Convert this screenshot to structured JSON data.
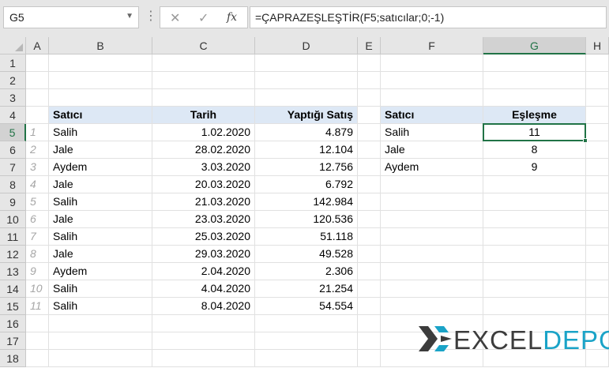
{
  "formula_bar": {
    "name_box": "G5",
    "cancel_glyph": "✕",
    "enter_glyph": "✓",
    "fx_label": "fx",
    "formula": "=ÇAPRAZEŞLEŞTİR(F5;satıcılar;0;-1)"
  },
  "columns": [
    "A",
    "B",
    "C",
    "D",
    "E",
    "F",
    "G",
    "H"
  ],
  "selected_column": "G",
  "selected_row": 5,
  "rows": [
    "1",
    "2",
    "3",
    "4",
    "5",
    "6",
    "7",
    "8",
    "9",
    "10",
    "11",
    "12",
    "13",
    "14",
    "15",
    "16",
    "17",
    "18"
  ],
  "table1": {
    "headers": [
      "Satıcı",
      "Tarih",
      "Yaptığı Satış"
    ],
    "rows": [
      {
        "idx": "1",
        "satici": "Salih",
        "tarih": "1.02.2020",
        "satis": "4.879"
      },
      {
        "idx": "2",
        "satici": "Jale",
        "tarih": "28.02.2020",
        "satis": "12.104"
      },
      {
        "idx": "3",
        "satici": "Aydem",
        "tarih": "3.03.2020",
        "satis": "12.756"
      },
      {
        "idx": "4",
        "satici": "Jale",
        "tarih": "20.03.2020",
        "satis": "6.792"
      },
      {
        "idx": "5",
        "satici": "Salih",
        "tarih": "21.03.2020",
        "satis": "142.984"
      },
      {
        "idx": "6",
        "satici": "Jale",
        "tarih": "23.03.2020",
        "satis": "120.536"
      },
      {
        "idx": "7",
        "satici": "Salih",
        "tarih": "25.03.2020",
        "satis": "51.118"
      },
      {
        "idx": "8",
        "satici": "Jale",
        "tarih": "29.03.2020",
        "satis": "49.528"
      },
      {
        "idx": "9",
        "satici": "Aydem",
        "tarih": "2.04.2020",
        "satis": "2.306"
      },
      {
        "idx": "10",
        "satici": "Salih",
        "tarih": "4.04.2020",
        "satis": "21.254"
      },
      {
        "idx": "11",
        "satici": "Salih",
        "tarih": "8.04.2020",
        "satis": "54.554"
      }
    ]
  },
  "table2": {
    "headers": [
      "Satıcı",
      "Eşleşme"
    ],
    "rows": [
      {
        "satici": "Salih",
        "eslesme": "11"
      },
      {
        "satici": "Jale",
        "eslesme": "8"
      },
      {
        "satici": "Aydem",
        "eslesme": "9"
      }
    ]
  },
  "logo": {
    "part1": "EXCEL",
    "part2": "DEPO",
    "color_dark": "#3c3c3c",
    "color_accent": "#1aa3c7"
  },
  "colors": {
    "excel_green": "#217346",
    "header_fill": "#dde8f5"
  }
}
